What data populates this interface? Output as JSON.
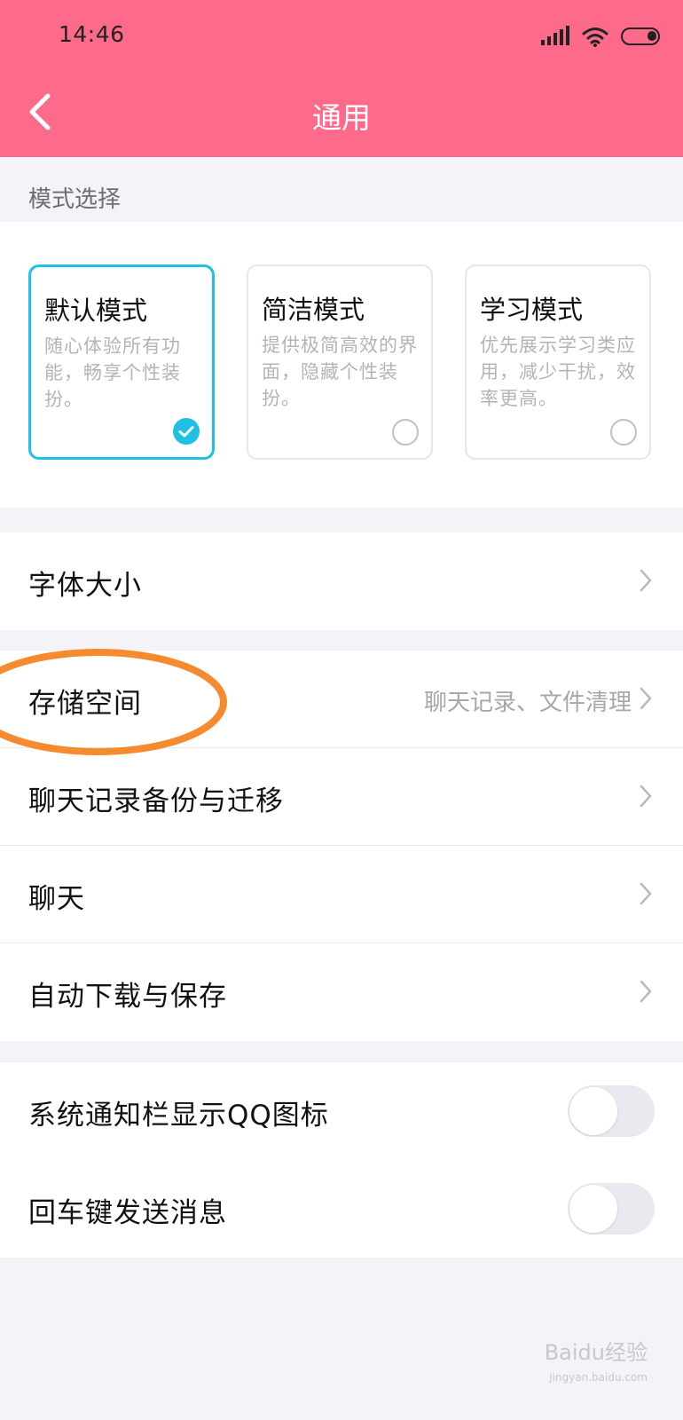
{
  "status_bar": {
    "time": "14:46"
  },
  "header": {
    "title": "通用"
  },
  "mode_section": {
    "label": "模式选择",
    "modes": [
      {
        "title": "默认模式",
        "description": "随心体验所有功能，畅享个性装扮。",
        "selected": true
      },
      {
        "title": "简洁模式",
        "description": "提供极简高效的界面，隐藏个性装扮。",
        "selected": false
      },
      {
        "title": "学习模式",
        "description": "优先展示学习类应用，减少干扰，效率更高。",
        "selected": false
      }
    ]
  },
  "settings": {
    "font_size": {
      "label": "字体大小"
    },
    "storage": {
      "label": "存储空间",
      "value": "聊天记录、文件清理"
    },
    "backup": {
      "label": "聊天记录备份与迁移"
    },
    "chat": {
      "label": "聊天"
    },
    "auto_download": {
      "label": "自动下载与保存"
    },
    "notify_icon": {
      "label": "系统通知栏显示QQ图标",
      "enabled": false
    },
    "enter_send": {
      "label": "回车键发送消息",
      "enabled": false
    }
  },
  "colors": {
    "header": "#fd6a8a",
    "accent": "#1ec0e3",
    "annotation": "#f58a2e"
  },
  "watermark": {
    "text": "Baidu经验",
    "sub": "jingyan.baidu.com"
  }
}
